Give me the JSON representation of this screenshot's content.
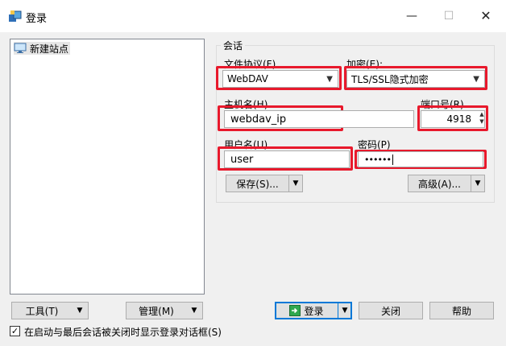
{
  "window": {
    "title": "登录",
    "minimize": "—",
    "maximize": "☐",
    "close": "✕"
  },
  "site_tree": {
    "items": [
      {
        "label": "新建站点",
        "icon": "monitor-icon"
      }
    ]
  },
  "session": {
    "group_title": "会话",
    "protocol": {
      "label": "文件协议(F)",
      "value": "WebDAV"
    },
    "encryption": {
      "label": "加密(E):",
      "value": "TLS/SSL隐式加密"
    },
    "host": {
      "label": "主机名(H)",
      "value": "webdav_ip"
    },
    "port": {
      "label": "端口号(R)",
      "value": "4918"
    },
    "username": {
      "label": "用户名(U)",
      "value": "user"
    },
    "password": {
      "label": "密码(P)",
      "value": "••••••"
    },
    "save_label": "保存(S)...",
    "advanced_label": "高级(A)..."
  },
  "bottom": {
    "tools_label": "工具(T)",
    "manage_label": "管理(M)",
    "login_label": "登录",
    "close_label": "关闭",
    "help_label": "帮助",
    "checkbox_label": "在启动与最后会话被关闭时显示登录对话框(S)",
    "checkbox_checked": true
  },
  "colors": {
    "highlight": "#e8192c",
    "focus": "#0078d7"
  }
}
